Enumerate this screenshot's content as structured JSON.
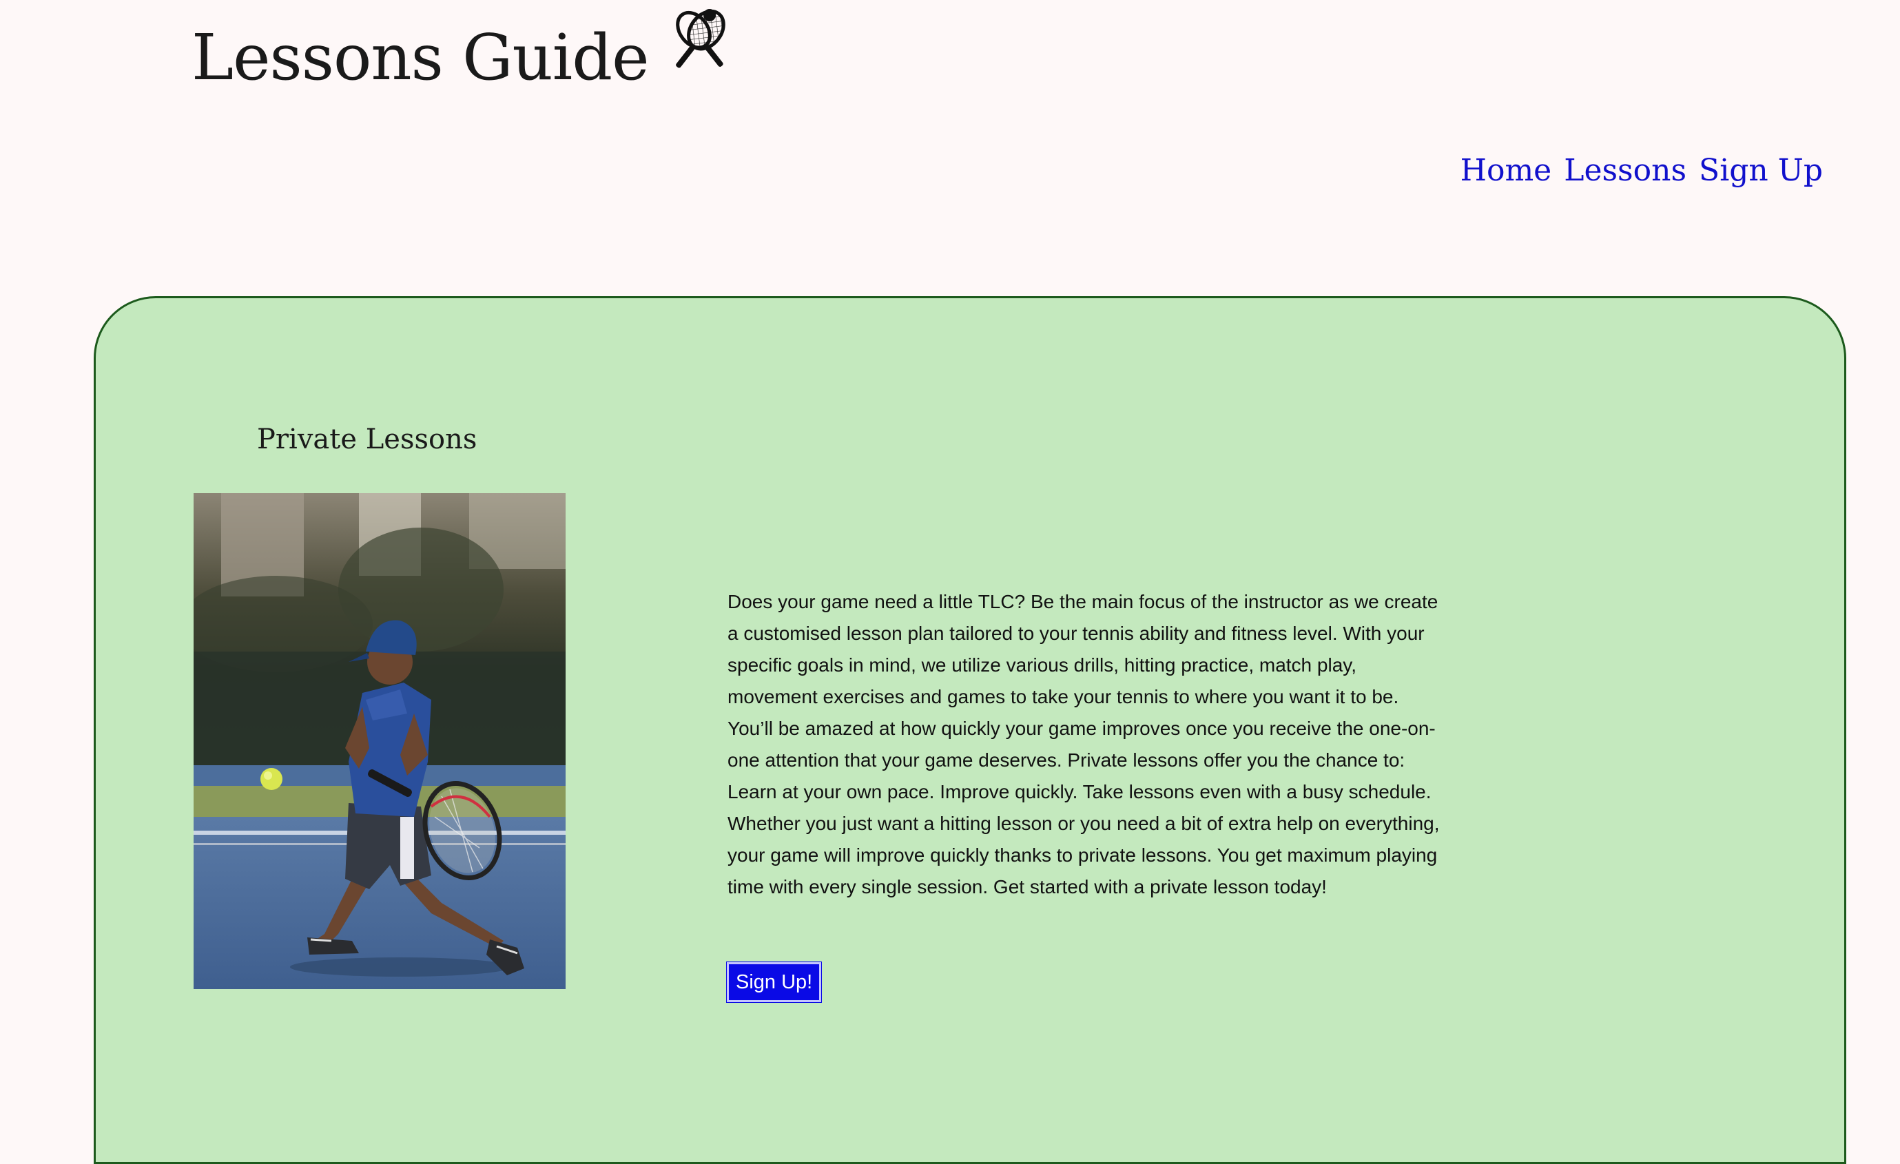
{
  "header": {
    "logo_text": "Lessons Guide",
    "logo_icon": "tennis-rackets-icon"
  },
  "nav": {
    "home": "Home",
    "lessons": "Lessons",
    "signup": "Sign Up"
  },
  "main": {
    "title": "Private Lessons",
    "image_subject": "boy-hitting-tennis-backhand-photo",
    "description": "Does your game need a little TLC? Be the main focus of the instructor as we create a customised lesson plan tailored to your tennis ability and fitness level. With your specific goals in mind, we utilize various drills, hitting practice, match play, movement exercises and games to take your tennis to where you want it to be. You’ll be amazed at how quickly your game improves once you receive the one-on-one attention that your game deserves. Private lessons offer you the chance to: Learn at your own pace. Improve quickly. Take lessons even with a busy schedule. Whether you just want a hitting lesson or you need a bit of extra help on everything, your game will improve quickly thanks to private lessons. You get maximum playing time with every single session. Get started with a private lesson today!",
    "button_label": "Sign Up!"
  },
  "colors": {
    "page_background": "#fef8f8",
    "panel_background": "#c4e9be",
    "panel_border": "#1c5a1c",
    "nav_link": "#1010cc",
    "button_background": "#0a0ae6"
  }
}
